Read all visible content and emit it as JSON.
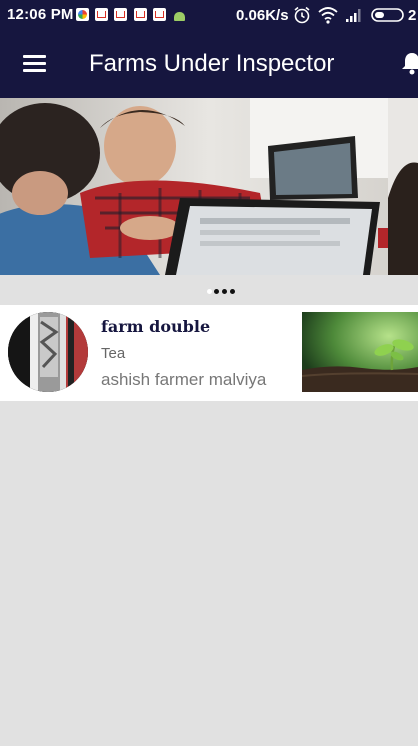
{
  "status_bar": {
    "time": "12:06 PM",
    "network_speed": "0.06K/s",
    "battery_text": "2",
    "notification_icons": [
      "photos-icon",
      "gmail-icon",
      "gmail-icon",
      "gmail-icon",
      "gmail-icon",
      "android-icon"
    ],
    "status_icons": [
      "alarm-icon",
      "wifi-icon",
      "signal-icon",
      "battery-icon"
    ]
  },
  "app_bar": {
    "title": "Farms Under Inspector",
    "menu_icon": "hamburger-menu-icon",
    "action_icon": "bell-icon"
  },
  "banner": {
    "slide_count": 4,
    "active_slide": 2
  },
  "farms": [
    {
      "name": "farm double",
      "crop": "Tea",
      "owner": "ashish farmer malviya"
    }
  ],
  "colors": {
    "primary": "#16163f",
    "background": "#e1e1e1",
    "card": "#ffffff"
  }
}
